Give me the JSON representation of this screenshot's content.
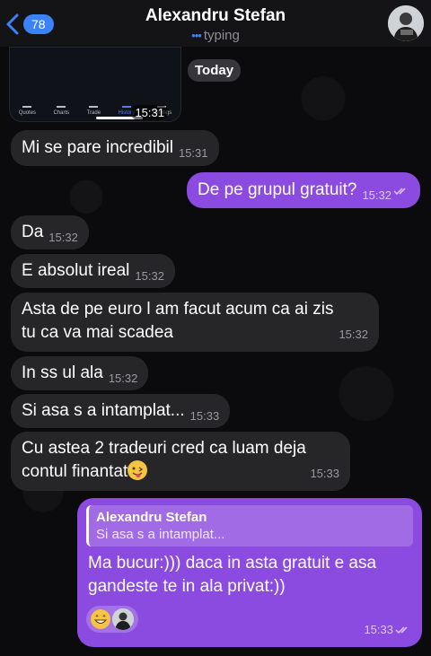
{
  "header": {
    "back_badge": "78",
    "title": "Alexandru Stefan",
    "status": "typing"
  },
  "screenshot": {
    "tabs": [
      "Quotes",
      "Charts",
      "Trade",
      "History",
      "Settings"
    ],
    "active_tab": "History",
    "time": "15:31"
  },
  "date_pill": "Today",
  "messages": [
    {
      "dir": "in",
      "text": "Mi se pare incredibil",
      "time": "15:31"
    },
    {
      "dir": "out",
      "text": "De pe grupul gratuit?",
      "time": "15:32"
    },
    {
      "dir": "in",
      "text": "Da",
      "time": "15:32"
    },
    {
      "dir": "in",
      "text": "E absolut ireal",
      "time": "15:32"
    },
    {
      "dir": "in",
      "lines": [
        "Asta de pe euro l am facut acum ca ai zis",
        "tu ca va mai scadea"
      ],
      "time": "15:32"
    },
    {
      "dir": "in",
      "text": "In ss ul ala",
      "time": "15:32"
    },
    {
      "dir": "in",
      "text": "Si asa s a intamplat...",
      "time": "15:33"
    },
    {
      "dir": "in",
      "lines": [
        "Cu astea 2 tradeuri cred ca luam deja",
        "contul finantat"
      ],
      "emoji": "face-with-tongue-emoji",
      "time": "15:33"
    },
    {
      "dir": "out",
      "reply": {
        "name": "Alexandru Stefan",
        "text": "Si asa s a intamplat..."
      },
      "lines": [
        "Ma bucur:))) daca in asta gratuit e asa",
        "gandeste te in ala privat:))"
      ],
      "reactions": [
        "grinning-emoji",
        "reactor-avatar"
      ],
      "time": "15:33"
    }
  ],
  "colors": {
    "accent": "#3b82f6",
    "incoming_bubble": "#262629",
    "outgoing_bubble": "#8b4be0",
    "background": "#0b0b0d"
  }
}
